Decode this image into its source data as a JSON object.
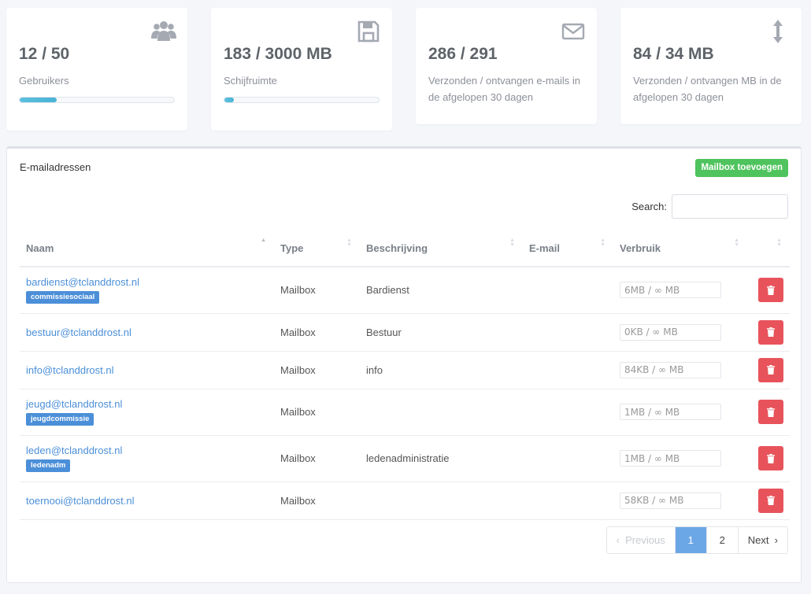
{
  "stats": [
    {
      "value": "12 / 50",
      "label": "Gebruikers",
      "icon": "users-icon",
      "progress": 0.24
    },
    {
      "value": "183 / 3000 MB",
      "label": "Schijfruimte",
      "icon": "floppy-disk-icon",
      "progress": 0.061
    },
    {
      "value": "286 / 291",
      "label": "Verzonden / ontvangen e-mails in de afgelopen 30 dagen",
      "icon": "envelope-icon"
    },
    {
      "value": "84 / 34 MB",
      "label": "Verzonden / ontvangen MB in de afgelopen 30 dagen",
      "icon": "vertical-arrows-icon"
    }
  ],
  "panel": {
    "title": "E-mailadressen",
    "add_button": "Mailbox toevoegen",
    "search_label": "Search:"
  },
  "table": {
    "headers": [
      "Naam",
      "Type",
      "Beschrijving",
      "E-mail",
      "Verbruik"
    ],
    "rows": [
      {
        "email": "bardienst@tclanddrost.nl",
        "tag": "commissiesociaal",
        "type": "Mailbox",
        "description": "Bardienst",
        "usage": "6MB / ∞ MB"
      },
      {
        "email": "bestuur@tclanddrost.nl",
        "tag": "",
        "type": "Mailbox",
        "description": "Bestuur",
        "usage": "0KB / ∞ MB"
      },
      {
        "email": "info@tclanddrost.nl",
        "tag": "",
        "type": "Mailbox",
        "description": "info",
        "usage": "84KB / ∞ MB"
      },
      {
        "email": "jeugd@tclanddrost.nl",
        "tag": "jeugdcommissie",
        "type": "Mailbox",
        "description": "",
        "usage": "1MB / ∞ MB"
      },
      {
        "email": "leden@tclanddrost.nl",
        "tag": "ledenadm",
        "type": "Mailbox",
        "description": "ledenadministratie",
        "usage": "1MB / ∞ MB"
      },
      {
        "email": "toernooi@tclanddrost.nl",
        "tag": "",
        "type": "Mailbox",
        "description": "",
        "usage": "58KB / ∞ MB"
      }
    ]
  },
  "pagination": {
    "previous": "Previous",
    "pages": [
      "1",
      "2"
    ],
    "current": "1",
    "next": "Next"
  },
  "colors": {
    "accent": "#4b8fd8",
    "success": "#4fc35d",
    "danger": "#e8535b",
    "progress": "#5bc0de"
  }
}
